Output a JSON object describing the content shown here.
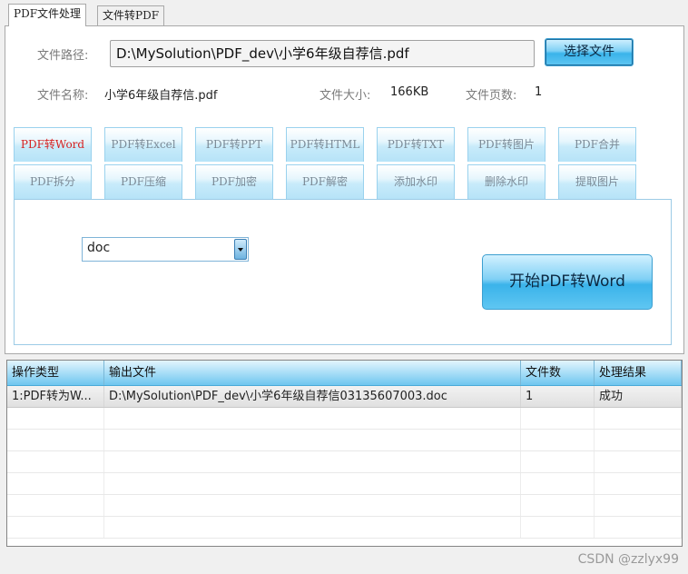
{
  "tabs": [
    "PDF文件处理",
    "文件转PDF"
  ],
  "file": {
    "path_label": "文件路径:",
    "path_value": "D:\\MySolution\\PDF_dev\\小学6年级自荐信.pdf",
    "choose_button": "选择文件",
    "name_label": "文件名称:",
    "name_value": "小学6年级自荐信.pdf",
    "size_label": "文件大小:",
    "size_value": "166KB",
    "pages_label": "文件页数:",
    "pages_value": "1"
  },
  "functions": [
    "PDF转Word",
    "PDF转Excel",
    "PDF转PPT",
    "PDF转HTML",
    "PDF转TXT",
    "PDF转图片",
    "PDF合并",
    "PDF拆分",
    "PDF压缩",
    "PDF加密",
    "PDF解密",
    "添加水印",
    "删除水印",
    "提取图片"
  ],
  "panel": {
    "format_selected": "doc",
    "start_button": "开始PDF转Word"
  },
  "grid": {
    "columns": [
      "操作类型",
      "输出文件",
      "文件数",
      "处理结果"
    ],
    "rows": [
      [
        "1:PDF转为W...",
        "D:\\MySolution\\PDF_dev\\小学6年级自荐信03135607003.doc",
        "1",
        "成功"
      ]
    ]
  },
  "watermark": "CSDN @zzlyx99",
  "colors": {
    "accent": "#3ab3ea",
    "active_function_text": "#d62020",
    "function_text": "#7b8a96"
  }
}
